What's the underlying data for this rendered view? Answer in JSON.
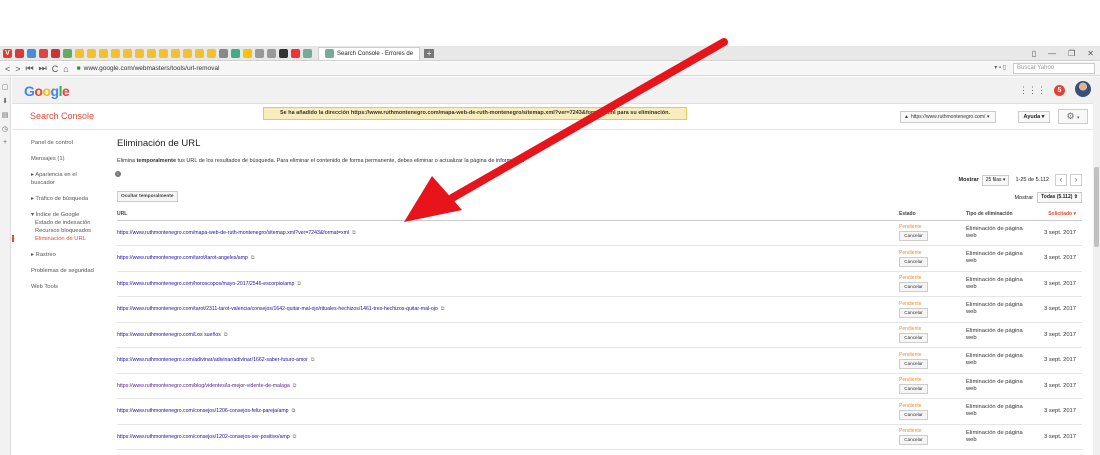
{
  "browser": {
    "tab_title": "Search Console - Errores de",
    "url": "www.google.com/webmasters/tools/url-removal",
    "search_placeholder": "Buscar Yahoo"
  },
  "google": {
    "logo": "Google",
    "notif_count": "5"
  },
  "header": {
    "product": "Search Console",
    "banner": "Se ha añadido la dirección https://www.ruthmontenegro.com/mapa-web-de-ruth-montenegro/sitemap.xml?ver=7243&format=xml para su eliminación.",
    "site": "https://www.ruthmontenegro.com/",
    "help": "Ayuda"
  },
  "nav": {
    "panel": "Panel de control",
    "messages": "Mensajes (1)",
    "appearance": "▸ Apariencia en el buscador",
    "traffic": "▸ Tráfico de búsqueda",
    "google_index": "▾ Índice de Google",
    "index_status": "Estado de indexación",
    "blocked": "Recursos bloqueados",
    "removal": "Eliminación de URL",
    "crawl": "▸ Rastreo",
    "security": "Problemas de seguridad",
    "web_tools": "Web Tools"
  },
  "main": {
    "title": "Eliminación de URL",
    "desc_prefix": "Elimina",
    "desc_bold": "temporalmente",
    "desc_rest": " tus URL de los resultados de búsqueda. Para eliminar el contenido de forma permanente, debes eliminar o actualizar la página de",
    "desc_link": "información",
    "show_label": "Mostrar",
    "rows_value": "25 filas",
    "range": "1-25 de 5.112",
    "hide_button": "Ocultar temporalmente",
    "filter_label": "Mostrar",
    "filter_value": "Todas (5.112)"
  },
  "table": {
    "headers": {
      "url": "URL",
      "status": "Estado",
      "type": "Tipo de eliminación",
      "requested": "Solicitado"
    },
    "status_text": "Pendiente",
    "cancel_label": "Cancelar",
    "type_line1": "Eliminación de página",
    "type_line2": "web",
    "date": "3 sept. 2017",
    "rows": [
      "https://www.ruthmontenegro.com/mapa-web-de-ruth-montenegro/sitemap.xml?ver=7243&format=xml",
      "https://www.ruthmontenegro.com/tarot/tarot-angeles/amp",
      "https://www.ruthmontenegro.com/horoscopos/mayo-2017/2546-escorpio/amp",
      "https://www.ruthmontenegro.com/tarot/2311-tarot-valencia/consejos/1642-quitar-mal-ojo/rituales-hechizos/1461-tres-hechizos-quitar-mal-ojo",
      "https://www.ruthmontenegro.com/Los sueños",
      "https://www.ruthmontenegro.com/adivinar/adivinar/adivinar/1662-saber-futuro-amor",
      "https://www.ruthmontenegro.com/blog/videntes/la-mejor-vidente-de-malaga",
      "https://www.ruthmontenegro.com/consejos/1206-consejos-feliz-pareja/amp",
      "https://www.ruthmontenegro.com/consejos/1202-consejos-ser-positivo/amp"
    ]
  }
}
